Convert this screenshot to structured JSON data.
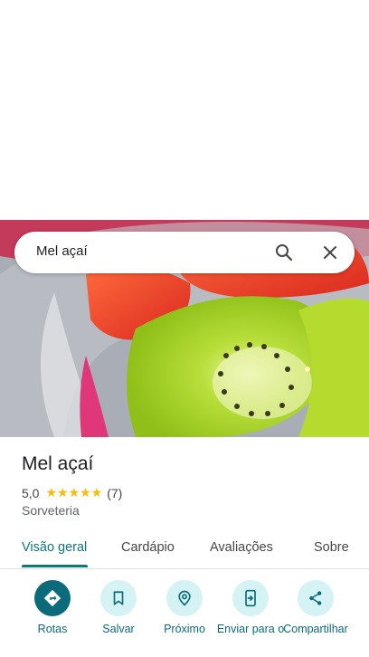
{
  "search": {
    "query": "Mel açaí"
  },
  "place": {
    "title": "Mel açaí",
    "rating": "5,0",
    "stars": "★★★★★",
    "reviews": "(7)",
    "category": "Sorveteria"
  },
  "tabs": [
    {
      "label": "Visão geral",
      "active": true
    },
    {
      "label": "Cardápio",
      "active": false
    },
    {
      "label": "Avaliações",
      "active": false
    },
    {
      "label": "Sobre",
      "active": false
    }
  ],
  "actions": [
    {
      "label": "Rotas",
      "icon": "directions-icon"
    },
    {
      "label": "Salvar",
      "icon": "bookmark-icon"
    },
    {
      "label": "Próximo",
      "icon": "nearby-icon"
    },
    {
      "label": "Enviar para o",
      "icon": "send-to-phone-icon"
    },
    {
      "label": "Compartilhar",
      "icon": "share-icon"
    }
  ],
  "colors": {
    "accent": "#0b7a7a",
    "action_bg": "#d5f2f5",
    "star": "#fbbc04"
  }
}
